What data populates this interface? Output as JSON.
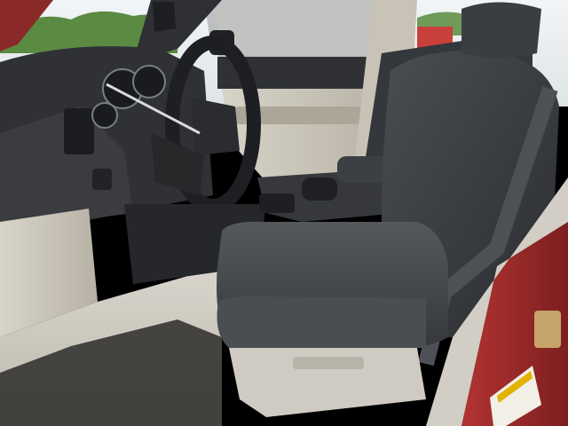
{
  "scene": {
    "subject": "car-interior-driver-side",
    "colors": {
      "seat": "#3a3d42",
      "seat_shadow": "#26282c",
      "dash": "#2f3135",
      "door_panel": "#c9c4b6",
      "door_trim": "#8d887c",
      "body_red": "#9c2b2a",
      "floor_carpet": "#2b2b2e",
      "sky": "#e9eef2",
      "trees": "#4f7a3a",
      "sill": "#b8b4aa"
    }
  }
}
